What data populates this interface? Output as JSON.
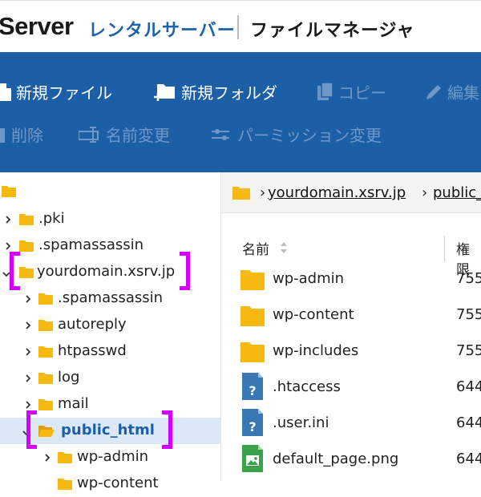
{
  "header": {
    "brand": "Server",
    "brand_sub": "レンタルサーバー",
    "app_title": "ファイルマネージャ"
  },
  "toolbar": {
    "new_file": "新規ファイル",
    "new_folder": "新規フォルダ",
    "copy": "コピー",
    "edit": "編集",
    "delete": "削除",
    "rename": "名前変更",
    "permission": "パーミッション変更"
  },
  "sidebar": {
    "items": [
      {
        "label": ".pki"
      },
      {
        "label": ".spamassassin"
      },
      {
        "label": "yourdomain.xsrv.jp"
      },
      {
        "label": ".spamassassin"
      },
      {
        "label": "autoreply"
      },
      {
        "label": "htpasswd"
      },
      {
        "label": "log"
      },
      {
        "label": "mail"
      },
      {
        "label": "public_html"
      },
      {
        "label": "wp-admin"
      },
      {
        "label": "wp-content"
      }
    ]
  },
  "breadcrumb": {
    "domain": "yourdomain.xsrv.jp",
    "folder": "public_"
  },
  "table": {
    "col_name": "名前",
    "col_perm": "権限",
    "rows": [
      {
        "name": "wp-admin",
        "perm": "755",
        "type": "folder"
      },
      {
        "name": "wp-content",
        "perm": "755",
        "type": "folder"
      },
      {
        "name": "wp-includes",
        "perm": "755",
        "type": "folder"
      },
      {
        "name": ".htaccess",
        "perm": "644",
        "type": "unknown"
      },
      {
        "name": ".user.ini",
        "perm": "644",
        "type": "unknown"
      },
      {
        "name": "default_page.png",
        "perm": "644",
        "type": "image"
      }
    ]
  },
  "colors": {
    "toolbar": "#1d5fa6",
    "folder": "#f5b912",
    "highlight": "#d400ff",
    "selected": "#dce8f5"
  }
}
